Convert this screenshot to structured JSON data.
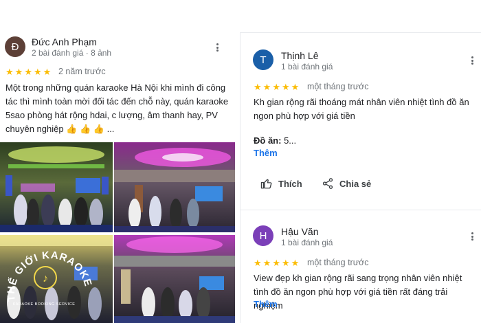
{
  "review1": {
    "avatar_letter": "Đ",
    "avatar_color": "#5d4037",
    "name": "Đức Anh Phạm",
    "meta": "2 bài đánh giá · 8 ảnh",
    "rating": 5,
    "time": "2 năm trước",
    "text": "Một trong những quán karaoke Hà Nội khi mình đi công tác thì mình toàn mời đối tác đến chỗ này, quán karaoke 5sao phòng hát rộng hdai, c lượng, âm thanh hay, PV chuyên nghiệp 👍 👍 👍 ...",
    "watermark": {
      "main": "THẾ GIỚI KARAOKE",
      "sub": "KARAOKE BOOKING SERVICE"
    }
  },
  "review2": {
    "avatar_letter": "T",
    "avatar_color": "#1a5fa8",
    "name": "Thịnh Lê",
    "meta": "1 bài đánh giá",
    "rating": 5,
    "time": "một tháng trước",
    "text": "Kh gian rộng rãi thoáng mát nhân viên nhiệt tình đồ ăn ngon phù hợp với giá tiền",
    "food_label": "Đồ ăn:",
    "food_value": "5...",
    "more_label": "Thêm",
    "like_label": "Thích",
    "share_label": "Chia sẻ"
  },
  "review3": {
    "avatar_letter": "H",
    "avatar_color": "#7b3fb8",
    "name": "Hậu Văn",
    "meta": "1 bài đánh giá",
    "rating": 5,
    "time": "một tháng trước",
    "text": "View đẹp kh gian rộng rãi sang trọng nhân viên nhiệt tình đồ ăn ngon phù hợp với giá tiền rất đáng trải nghiệm",
    "more_label": "Thêm"
  },
  "icons": {
    "more": "more-vert-icon",
    "star": "star-icon",
    "like": "thumbs-up-icon",
    "share": "share-icon"
  },
  "colors": {
    "star": "#fbbc04",
    "link": "#1a73e8",
    "muted": "#70757a"
  }
}
